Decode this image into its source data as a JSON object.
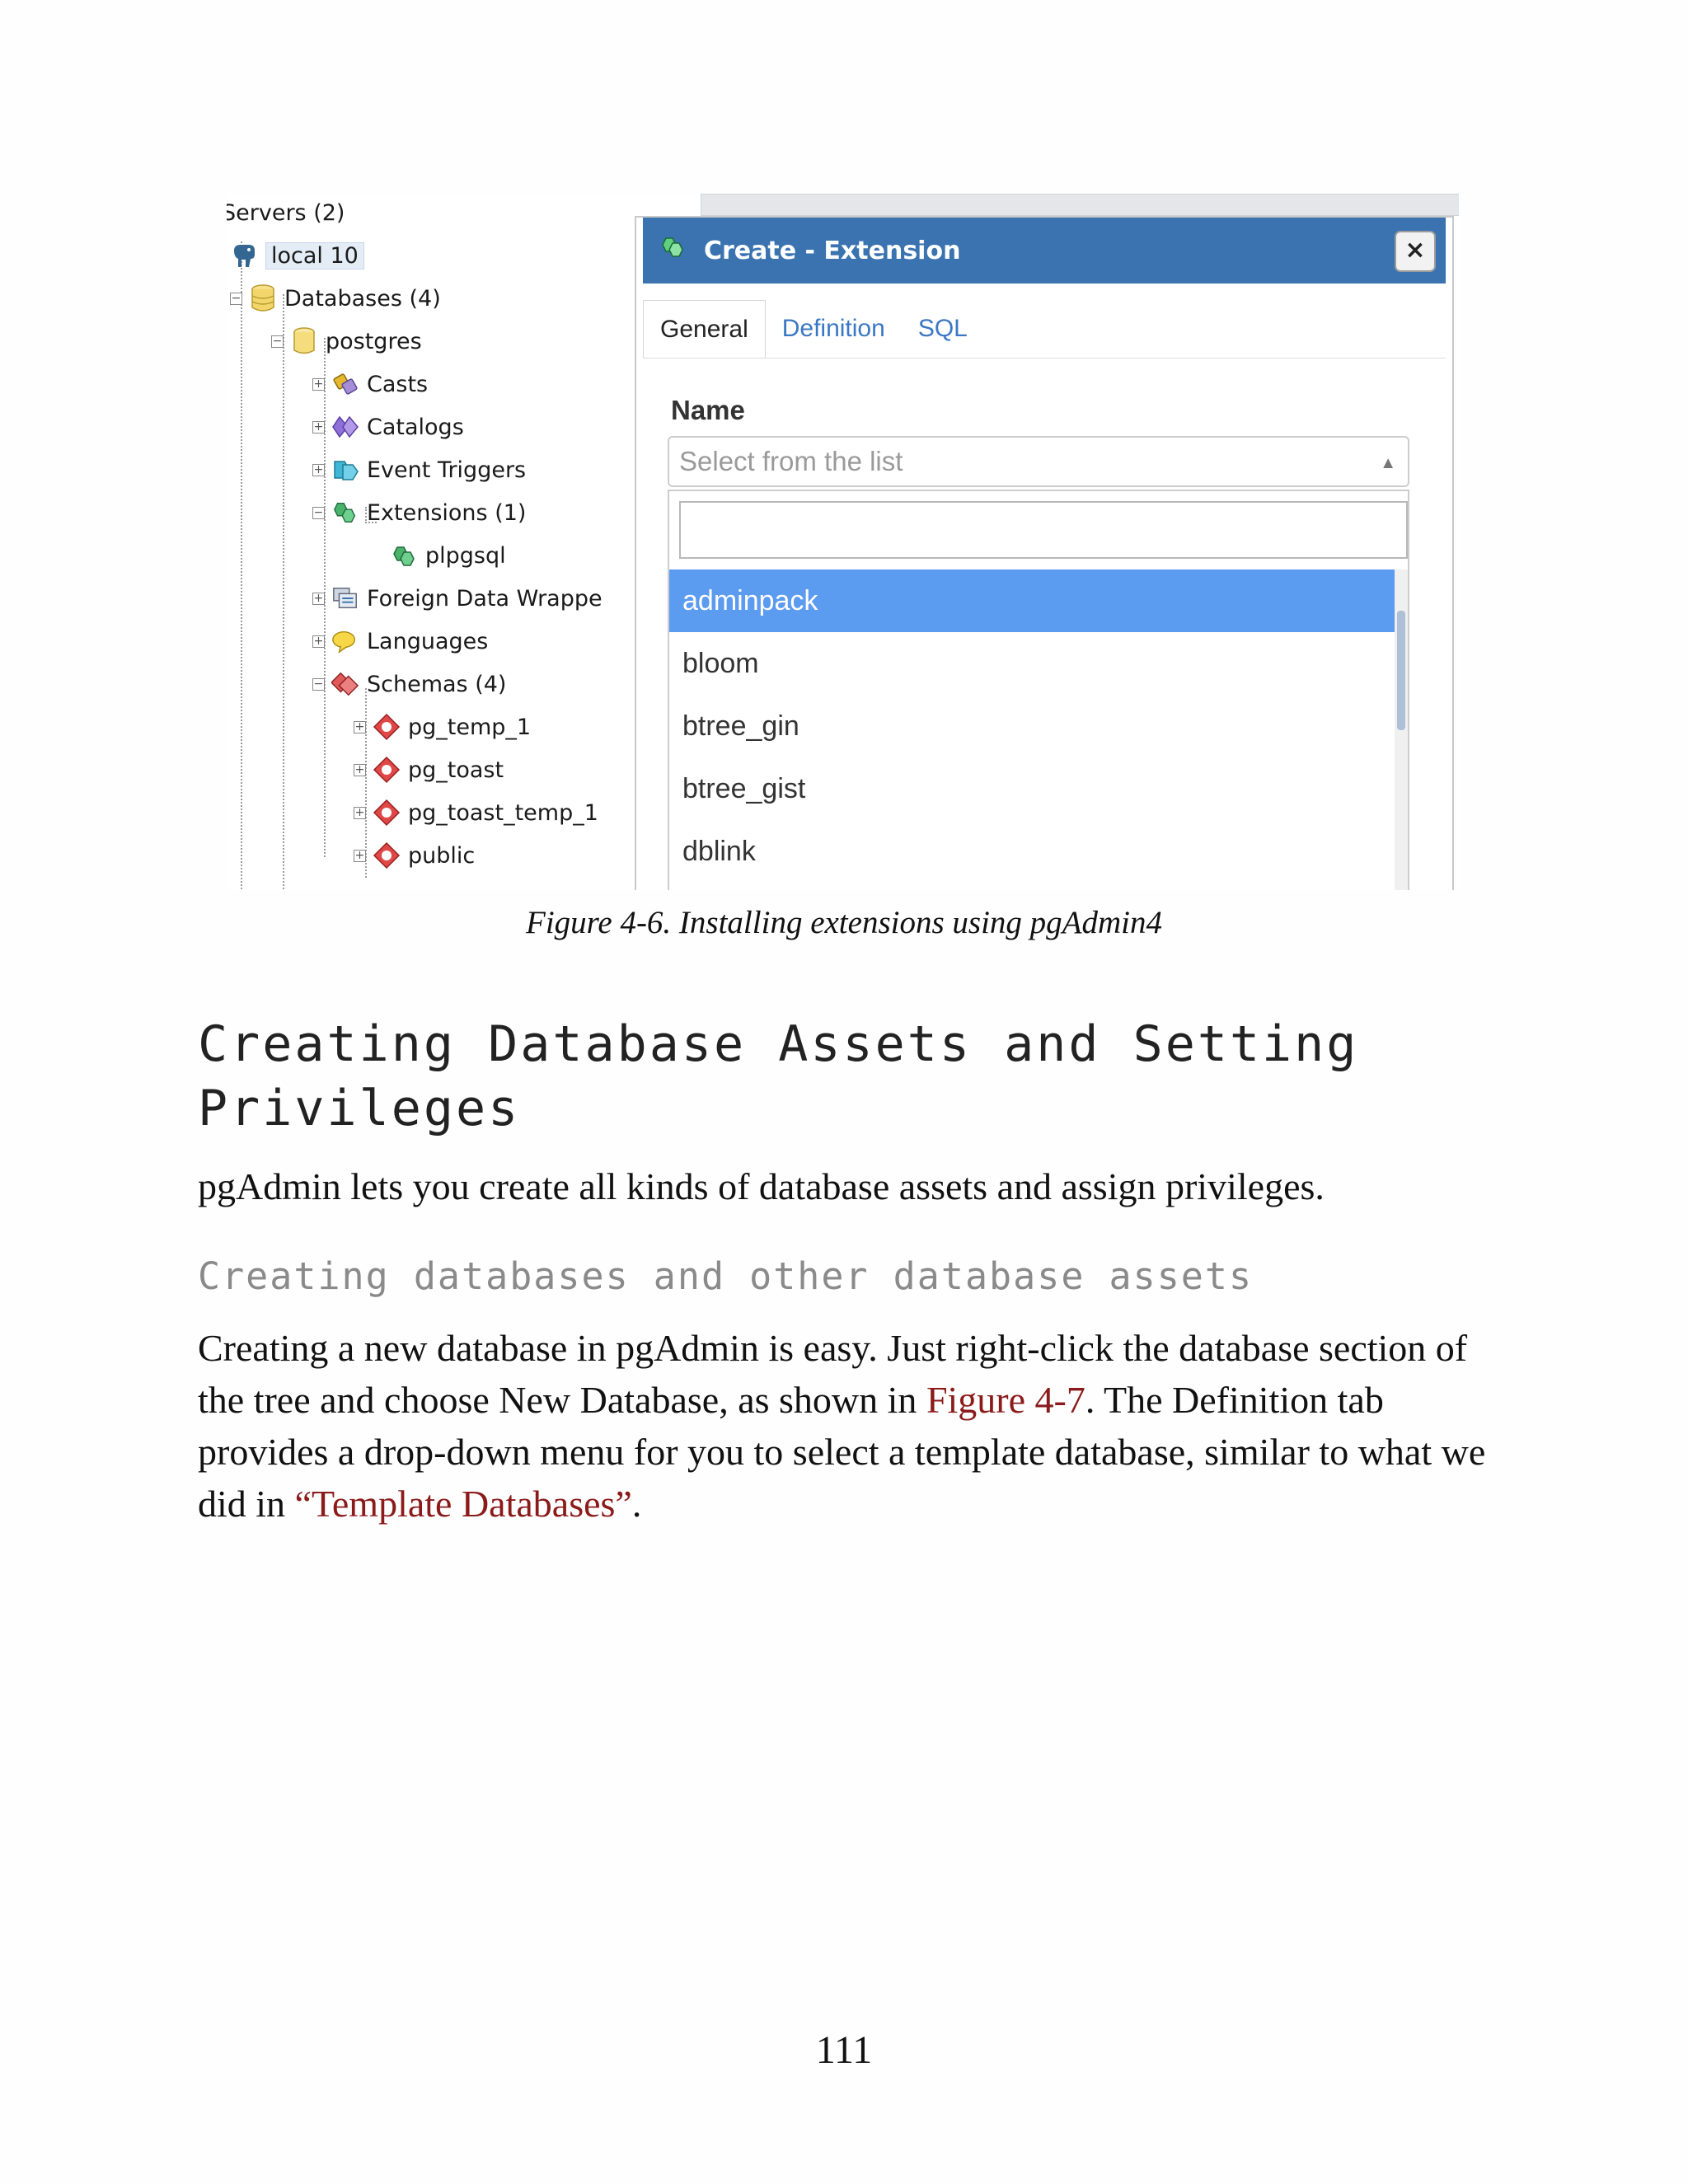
{
  "figure": {
    "tree": {
      "servers": "Servers (2)",
      "server": "local 10",
      "databases": "Databases (4)",
      "db": "postgres",
      "casts": "Casts",
      "catalogs": "Catalogs",
      "event_triggers": "Event Triggers",
      "extensions": "Extensions (1)",
      "plpgsql": "plpgsql",
      "fdw": "Foreign Data Wrappe",
      "languages": "Languages",
      "schemas": "Schemas (4)",
      "schema_items": [
        "pg_temp_1",
        "pg_toast",
        "pg_toast_temp_1",
        "public"
      ]
    },
    "dialog": {
      "title": "Create - Extension",
      "close": "×",
      "tabs": [
        "General",
        "Definition",
        "SQL"
      ],
      "name_label": "Name",
      "select_placeholder": "Select from the list",
      "search_value": "",
      "options": [
        "adminpack",
        "bloom",
        "btree_gin",
        "btree_gist",
        "dblink"
      ],
      "selected_option": "adminpack"
    },
    "colors": {
      "titlebar": "#3a73b0",
      "selected": "#5b9bf0",
      "link": "#8b1a1a"
    }
  },
  "caption": "Figure 4-6. Installing extensions using pgAdmin4",
  "heading": "Creating Database Assets and Setting Privileges",
  "intro": "pgAdmin lets you create all kinds of database assets and assign privileges.",
  "subheading": "Creating databases and other database assets",
  "paragraph": {
    "part1": "Creating a new database in pgAdmin is easy. Just right-click the database section of the tree and choose New Database, as shown in ",
    "link1": "Figure 4-7",
    "part2": ". The Definition tab provides a drop-down menu for you to select a template database, similar to what we did in ",
    "link2": "“Template Databases”",
    "part3": "."
  },
  "page_number": "111"
}
